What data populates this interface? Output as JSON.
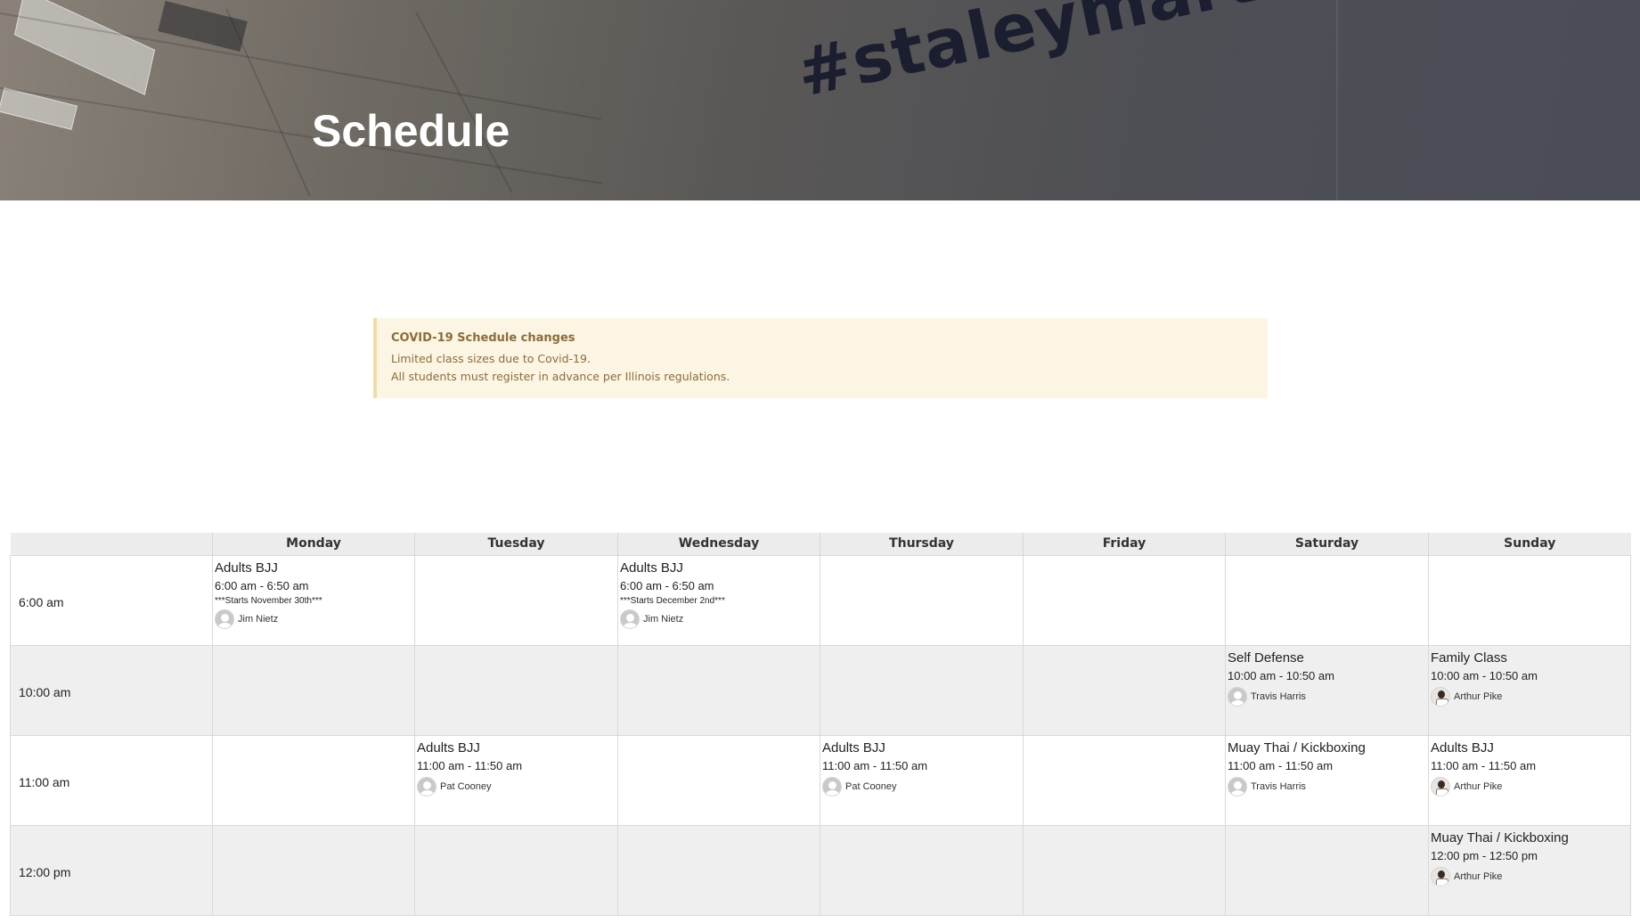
{
  "hero": {
    "title": "Schedule",
    "background_text": "#staleymartialart"
  },
  "notice": {
    "title": "COVID-19 Schedule changes",
    "lines": [
      "Limited class sizes due to Covid-19.",
      "All students must register in advance per Illinois regulations."
    ]
  },
  "schedule": {
    "days": [
      "Monday",
      "Tuesday",
      "Wednesday",
      "Thursday",
      "Friday",
      "Saturday",
      "Sunday"
    ],
    "rows": [
      {
        "time": "6:00 am",
        "cells": [
          {
            "name": "Adults BJJ",
            "time": "6:00 am - 6:50 am",
            "note": "***Starts November 30th***",
            "instructor": "Jim Nietz",
            "avatar": "default-avatar-icon"
          },
          null,
          {
            "name": "Adults BJJ",
            "time": "6:00 am - 6:50 am",
            "note": "***Starts December 2nd***",
            "instructor": "Jim Nietz",
            "avatar": "default-avatar-icon"
          },
          null,
          null,
          null,
          null
        ]
      },
      {
        "time": "10:00 am",
        "cells": [
          null,
          null,
          null,
          null,
          null,
          {
            "name": "Self Defense",
            "time": "10:00 am - 10:50 am",
            "instructor": "Travis Harris",
            "avatar": "default-avatar-icon"
          },
          {
            "name": "Family Class",
            "time": "10:00 am - 10:50 am",
            "instructor": "Arthur Pike",
            "avatar": "photo-avatar-icon"
          }
        ]
      },
      {
        "time": "11:00 am",
        "cells": [
          null,
          {
            "name": "Adults BJJ",
            "time": "11:00 am - 11:50 am",
            "instructor": "Pat Cooney",
            "avatar": "default-avatar-icon"
          },
          null,
          {
            "name": "Adults BJJ",
            "time": "11:00 am - 11:50 am",
            "instructor": "Pat Cooney",
            "avatar": "default-avatar-icon"
          },
          null,
          {
            "name": "Muay Thai / Kickboxing",
            "time": "11:00 am - 11:50 am",
            "instructor": "Travis Harris",
            "avatar": "default-avatar-icon"
          },
          {
            "name": "Adults BJJ",
            "time": "11:00 am - 11:50 am",
            "instructor": "Arthur Pike",
            "avatar": "photo-avatar-icon"
          }
        ]
      },
      {
        "time": "12:00 pm",
        "cells": [
          null,
          null,
          null,
          null,
          null,
          null,
          {
            "name": "Muay Thai / Kickboxing",
            "time": "12:00 pm - 12:50 pm",
            "instructor": "Arthur Pike",
            "avatar": "photo-avatar-icon"
          }
        ]
      }
    ]
  }
}
